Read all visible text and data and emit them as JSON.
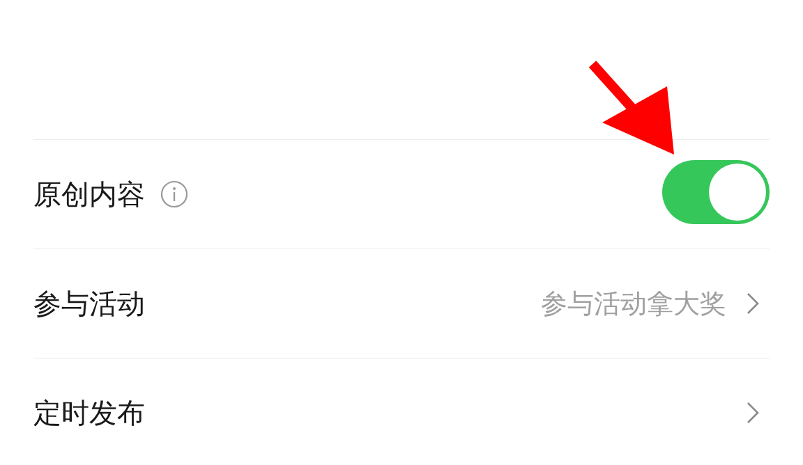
{
  "rows": [
    {
      "kind": "toggle",
      "label": "原创内容",
      "info": true,
      "on": true
    },
    {
      "kind": "link",
      "label": "参与活动",
      "value": "参与活动拿大奖"
    },
    {
      "kind": "link",
      "label": "定时发布"
    }
  ]
}
